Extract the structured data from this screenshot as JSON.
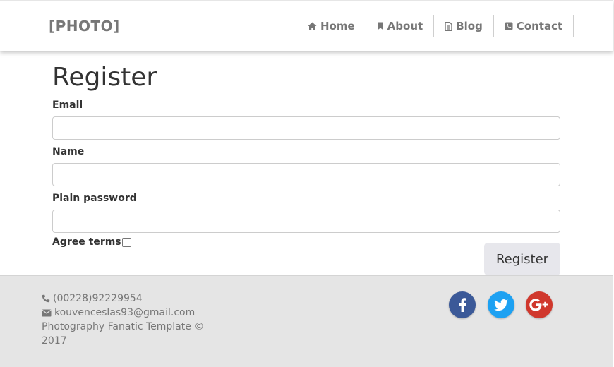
{
  "brand": "[PHOTO]",
  "nav": {
    "items": [
      {
        "label": "Home",
        "icon": "home-icon"
      },
      {
        "label": "About",
        "icon": "bookmark-icon"
      },
      {
        "label": "Blog",
        "icon": "document-icon"
      },
      {
        "label": "Contact",
        "icon": "phone-icon"
      }
    ]
  },
  "form": {
    "title": "Register",
    "email_label": "Email",
    "email_value": "",
    "name_label": "Name",
    "name_value": "",
    "password_label": "Plain password",
    "password_value": "",
    "agree_label": "Agree terms",
    "agree_checked": false,
    "submit_label": "Register"
  },
  "footer": {
    "phone": "(00228)92229954",
    "email": "kouvenceslas93@gmail.com",
    "copyright": "Photography Fanatic Template © 2017",
    "social": [
      "facebook-icon",
      "twitter-icon",
      "google-plus-icon"
    ]
  },
  "colors": {
    "facebook": "#3b5998",
    "twitter": "#1da1f2",
    "google_plus": "#d0382d",
    "footer_bg": "#e5e5e5",
    "button_bg": "#e7e7ec"
  }
}
